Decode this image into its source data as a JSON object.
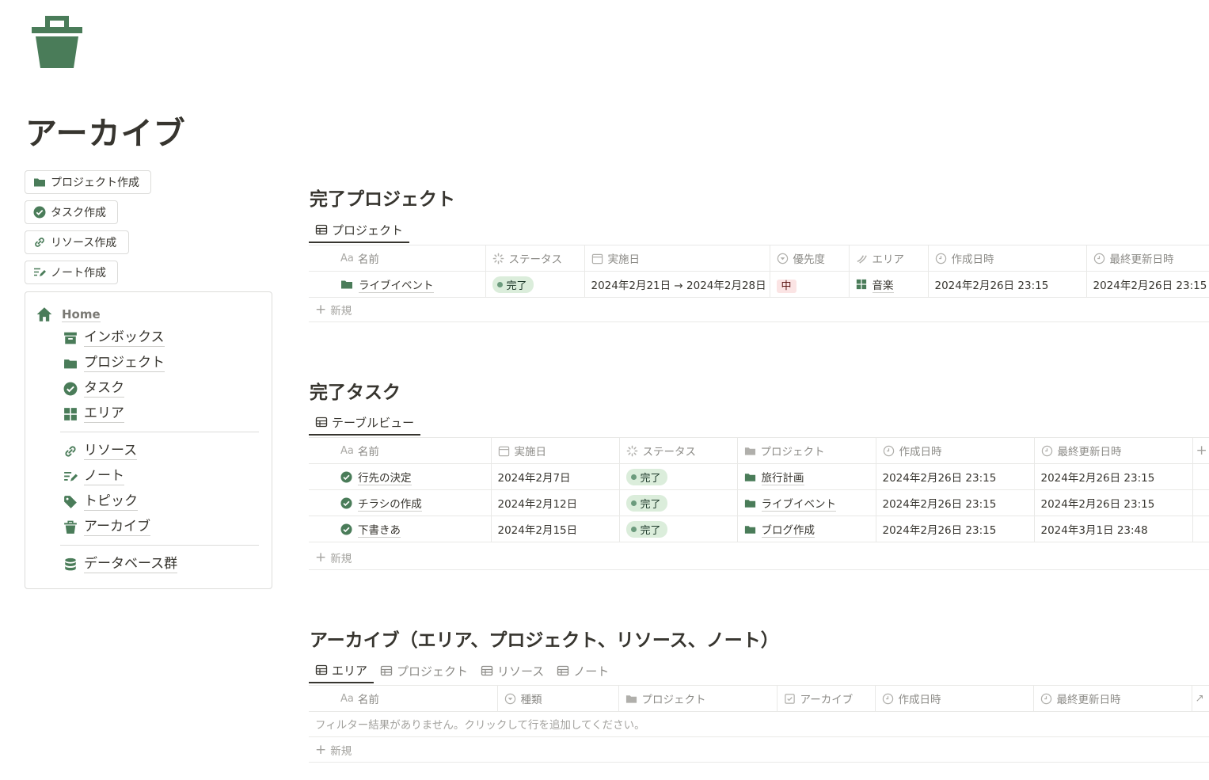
{
  "page": {
    "title": "アーカイブ",
    "icon": "trash-icon"
  },
  "colors": {
    "accent": "#4a7c59",
    "text": "#37352f",
    "muted": "#8c8b87",
    "border": "#e9e9e7"
  },
  "quick_buttons": [
    {
      "label": "プロジェクト作成",
      "icon": "folder-icon"
    },
    {
      "label": "タスク作成",
      "icon": "check-circle-icon"
    },
    {
      "label": "リソース作成",
      "icon": "link-icon"
    },
    {
      "label": "ノート作成",
      "icon": "note-icon"
    }
  ],
  "nav": {
    "home": "Home",
    "items": [
      "インボックス",
      "プロジェクト",
      "タスク",
      "エリア",
      "リソース",
      "ノート",
      "トピック",
      "アーカイブ",
      "データベース群"
    ]
  },
  "sections": {
    "projects": {
      "title": "完了プロジェクト",
      "view": "プロジェクト",
      "columns": [
        "名前",
        "ステータス",
        "実施日",
        "優先度",
        "エリア",
        "作成日時",
        "最終更新日時"
      ],
      "rows": [
        {
          "name": "ライブイベント",
          "status": "完了",
          "date": "2024年2月21日 → 2024年2月28日",
          "priority": "中",
          "area": "音楽",
          "created": "2024年2月26日 23:15",
          "updated": "2024年2月26日 23:15"
        }
      ],
      "new_label": "新規"
    },
    "tasks": {
      "title": "完了タスク",
      "view": "テーブルビュー",
      "columns": [
        "名前",
        "実施日",
        "ステータス",
        "プロジェクト",
        "作成日時",
        "最終更新日時"
      ],
      "rows": [
        {
          "name": "行先の決定",
          "date": "2024年2月7日",
          "status": "完了",
          "project": "旅行計画",
          "created": "2024年2月26日 23:15",
          "updated": "2024年2月26日 23:15"
        },
        {
          "name": "チラシの作成",
          "date": "2024年2月12日",
          "status": "完了",
          "project": "ライブイベント",
          "created": "2024年2月26日 23:15",
          "updated": "2024年2月26日 23:15"
        },
        {
          "name": "下書きあ",
          "date": "2024年2月15日",
          "status": "完了",
          "project": "ブログ作成",
          "created": "2024年2月26日 23:15",
          "updated": "2024年3月1日 23:48"
        }
      ],
      "new_label": "新規"
    },
    "archive": {
      "title": "アーカイブ（エリア、プロジェクト、リソース、ノート）",
      "views": [
        "エリア",
        "プロジェクト",
        "リソース",
        "ノート"
      ],
      "columns": [
        "名前",
        "種類",
        "プロジェクト",
        "アーカイブ",
        "作成日時",
        "最終更新日時"
      ],
      "empty_message": "フィルター結果がありません。クリックして行を追加してください。",
      "new_label": "新規"
    }
  }
}
